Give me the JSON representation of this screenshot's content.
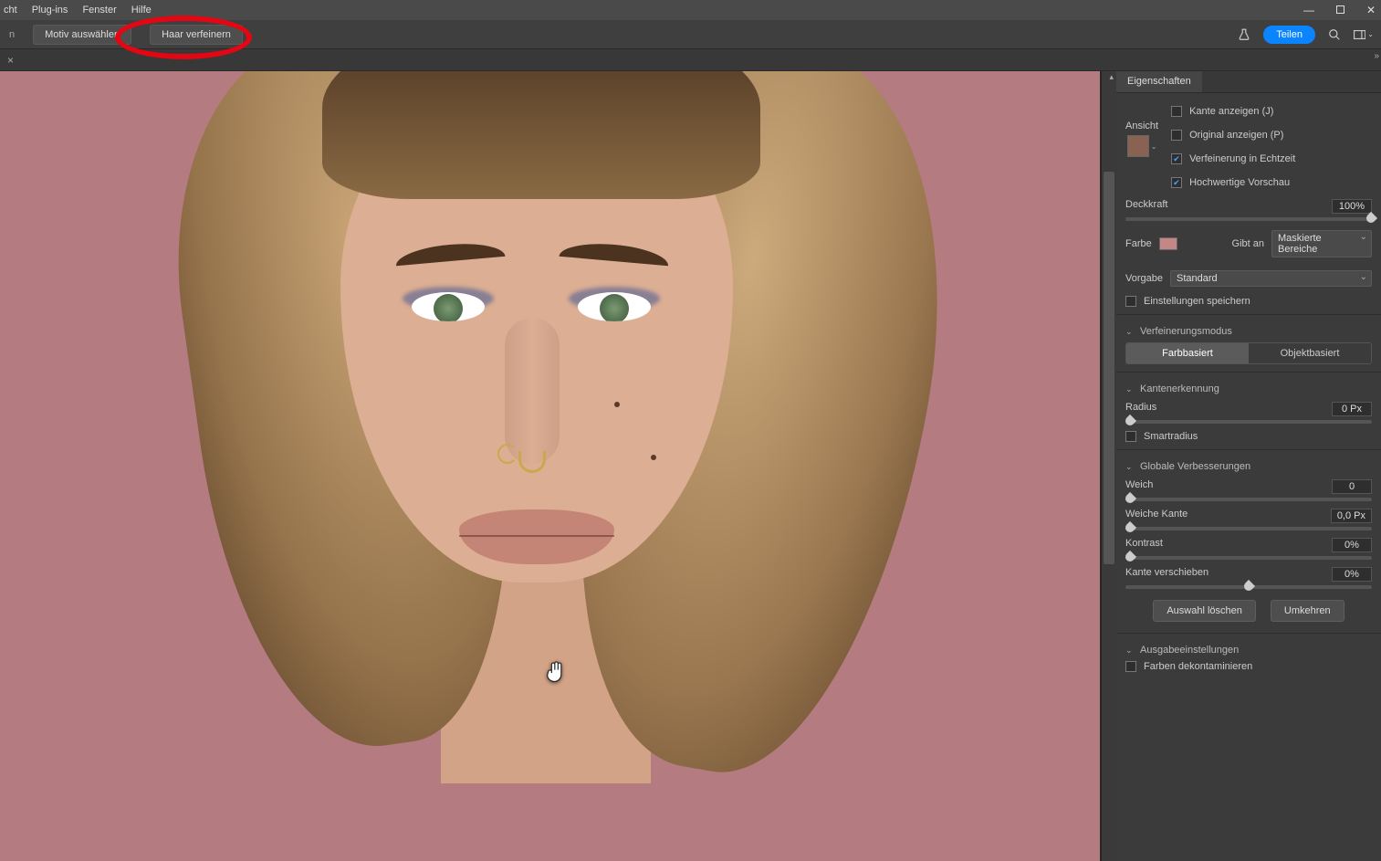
{
  "menu": {
    "items": [
      "cht",
      "Plug-ins",
      "Fenster",
      "Hilfe"
    ]
  },
  "optionsBar": {
    "leftLabel": "n",
    "btn1": "Motiv auswählen",
    "btn2": "Haar verfeinern",
    "share": "Teilen"
  },
  "panel": {
    "tab": "Eigenschaften",
    "view": {
      "label": "Ansicht"
    },
    "checks": {
      "showEdge": "Kante anzeigen (J)",
      "showOriginal": "Original anzeigen (P)",
      "realtime": "Verfeinerung in Echtzeit",
      "hq": "Hochwertige Vorschau"
    },
    "opacity": {
      "label": "Deckkraft",
      "value": "100%"
    },
    "color": {
      "label": "Farbe",
      "indicatesLabel": "Gibt an",
      "indicatesValue": "Maskierte Bereiche"
    },
    "preset": {
      "label": "Vorgabe",
      "value": "Standard"
    },
    "saveSettings": "Einstellungen speichern",
    "refineMode": {
      "title": "Verfeinerungsmodus",
      "opt1": "Farbbasiert",
      "opt2": "Objektbasiert"
    },
    "edgeDetect": {
      "title": "Kantenerkennung",
      "radius": {
        "label": "Radius",
        "value": "0 Px"
      },
      "smart": "Smartradius"
    },
    "global": {
      "title": "Globale Verbesserungen",
      "smooth": {
        "label": "Weich",
        "value": "0"
      },
      "feather": {
        "label": "Weiche Kante",
        "value": "0,0 Px"
      },
      "contrast": {
        "label": "Kontrast",
        "value": "0%"
      },
      "shift": {
        "label": "Kante verschieben",
        "value": "0%"
      },
      "clear": "Auswahl löschen",
      "invert": "Umkehren"
    },
    "output": {
      "title": "Ausgabeeinstellungen",
      "decontaminate": "Farben dekontaminieren"
    }
  }
}
